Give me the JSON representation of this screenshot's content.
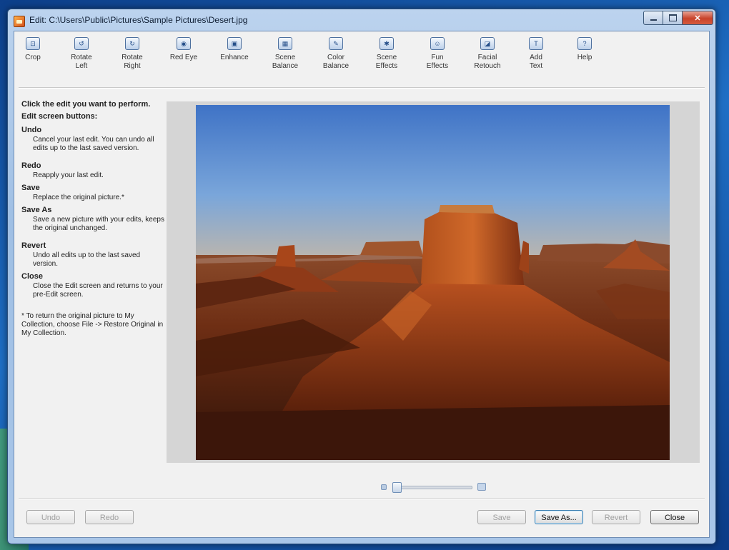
{
  "window": {
    "title": "Edit: C:\\Users\\Public\\Pictures\\Sample Pictures\\Desert.jpg"
  },
  "toolbar": {
    "items": [
      {
        "label": "Crop",
        "icon": "crop-icon"
      },
      {
        "label": "Rotate\nLeft",
        "icon": "rotate-left-icon"
      },
      {
        "label": "Rotate\nRight",
        "icon": "rotate-right-icon"
      },
      {
        "label": "Red Eye",
        "icon": "red-eye-icon"
      },
      {
        "label": "Enhance",
        "icon": "enhance-icon"
      },
      {
        "label": "Scene\nBalance",
        "icon": "scene-balance-icon"
      },
      {
        "label": "Color\nBalance",
        "icon": "color-balance-icon"
      },
      {
        "label": "Scene\nEffects",
        "icon": "scene-effects-icon"
      },
      {
        "label": "Fun\nEffects",
        "icon": "fun-effects-icon"
      },
      {
        "label": "Facial\nRetouch",
        "icon": "facial-retouch-icon"
      },
      {
        "label": "Add\nText",
        "icon": "add-text-icon"
      },
      {
        "label": "Help",
        "icon": "help-icon"
      }
    ]
  },
  "help": {
    "heading": "Click the edit you want to perform.",
    "subheading": "Edit screen buttons:",
    "items": [
      {
        "term": "Undo",
        "desc": "Cancel your last edit. You can undo all edits up to the last saved version."
      },
      {
        "term": "Redo",
        "desc": "Reapply your last edit."
      },
      {
        "term": "Save",
        "desc": "Replace the original picture.*"
      },
      {
        "term": "Save As",
        "desc": "Save a new picture with your edits, keeps the original unchanged."
      },
      {
        "term": "Revert",
        "desc": "Undo all edits up to the last saved version."
      },
      {
        "term": "Close",
        "desc": "Close the Edit screen and returns to your pre-Edit screen."
      }
    ],
    "note": "* To return the original picture to My Collection, choose File -> Restore Original in My Collection."
  },
  "zoom": {
    "level_fraction": 0.0
  },
  "buttons": {
    "undo": "Undo",
    "redo": "Redo",
    "save": "Save",
    "save_as": "Save As...",
    "revert": "Revert",
    "close": "Close"
  },
  "colors": {
    "titlebar": "#a9c6e8",
    "client": "#f1f1f1",
    "viewer_bg": "#d5d5d5",
    "close_button": "#c8432a"
  }
}
